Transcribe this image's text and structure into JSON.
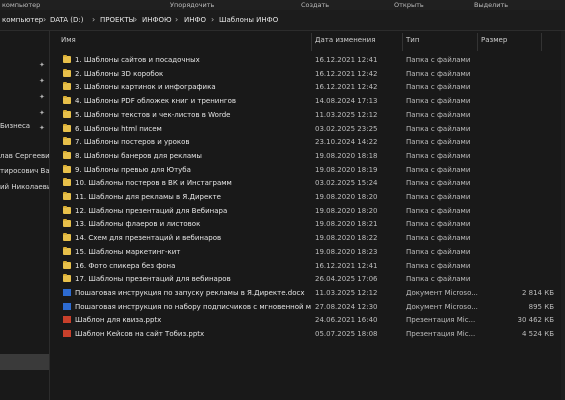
{
  "ribbon": {
    "items": [
      "компьютер",
      "Упорядочить",
      "Создать",
      "Открыть",
      "Выделить"
    ]
  },
  "address": {
    "crumbs": [
      "компьютер",
      "DATA (D:)",
      "ПРОЕКТЫ",
      "ИНФОЮ",
      "ИНФО",
      "Шаблоны ИНФО"
    ]
  },
  "nav": {
    "items": [
      "Бизнеса",
      "лав Сергеевич",
      "тиросович Вар",
      "ий Николаевич"
    ]
  },
  "columns": {
    "name": "Имя",
    "date": "Дата изменения",
    "type": "Тип",
    "size": "Размер"
  },
  "files": [
    {
      "name": "1. Шаблоны сайтов и посадочных",
      "date": "16.12.2021 12:41",
      "type": "Папка с файлами",
      "size": "",
      "icon": "folder"
    },
    {
      "name": "2. Шаблоны 3D коробок",
      "date": "16.12.2021 12:42",
      "type": "Папка с файлами",
      "size": "",
      "icon": "folder"
    },
    {
      "name": "3. Шаблоны картинок и инфографика",
      "date": "16.12.2021 12:42",
      "type": "Папка с файлами",
      "size": "",
      "icon": "folder"
    },
    {
      "name": "4. Шаблоны PDF обложек книг и тренингов",
      "date": "14.08.2024 17:13",
      "type": "Папка с файлами",
      "size": "",
      "icon": "folder"
    },
    {
      "name": "5. Шаблоны текстов и чек-листов в Worde",
      "date": "11.03.2025 12:12",
      "type": "Папка с файлами",
      "size": "",
      "icon": "folder"
    },
    {
      "name": "6. Шаблоны html писем",
      "date": "03.02.2025 23:25",
      "type": "Папка с файлами",
      "size": "",
      "icon": "folder"
    },
    {
      "name": "7. Шаблоны постеров и уроков",
      "date": "23.10.2024 14:22",
      "type": "Папка с файлами",
      "size": "",
      "icon": "folder"
    },
    {
      "name": "8. Шаблоны банеров для рекламы",
      "date": "19.08.2020 18:18",
      "type": "Папка с файлами",
      "size": "",
      "icon": "folder"
    },
    {
      "name": "9. Шаблоны превью для Ютуба",
      "date": "19.08.2020 18:19",
      "type": "Папка с файлами",
      "size": "",
      "icon": "folder"
    },
    {
      "name": "10. Шаблоны постеров в ВК и Инстаграмм",
      "date": "03.02.2025 15:24",
      "type": "Папка с файлами",
      "size": "",
      "icon": "folder"
    },
    {
      "name": "11. Шаблоны для рекламы в Я.Директе",
      "date": "19.08.2020 18:20",
      "type": "Папка с файлами",
      "size": "",
      "icon": "folder"
    },
    {
      "name": "12. Шаблоны презентаций для Вебинара",
      "date": "19.08.2020 18:20",
      "type": "Папка с файлами",
      "size": "",
      "icon": "folder"
    },
    {
      "name": "13. Шаблоны флаеров и листовок",
      "date": "19.08.2020 18:21",
      "type": "Папка с файлами",
      "size": "",
      "icon": "folder"
    },
    {
      "name": "14. Схем для презентаций и вебинаров",
      "date": "19.08.2020 18:22",
      "type": "Папка с файлами",
      "size": "",
      "icon": "folder"
    },
    {
      "name": "15. Шаблоны маркетинг-кит",
      "date": "19.08.2020 18:23",
      "type": "Папка с файлами",
      "size": "",
      "icon": "folder"
    },
    {
      "name": "16. Фото спикера без фона",
      "date": "16.12.2021 12:41",
      "type": "Папка с файлами",
      "size": "",
      "icon": "folder"
    },
    {
      "name": "17. Шаблоны презентаций для вебинаров",
      "date": "26.04.2025 17:06",
      "type": "Папка с файлами",
      "size": "",
      "icon": "folder"
    },
    {
      "name": "Пошаговая инструкция по запуску рекламы в Я.Директе.docx",
      "date": "11.03.2025 12:12",
      "type": "Документ Microso...",
      "size": "2 814 КБ",
      "icon": "docx"
    },
    {
      "name": "Пошаговая инструкция по набору подписчиков с мгновенной м...",
      "date": "27.08.2024 12:30",
      "type": "Документ Microso...",
      "size": "895 КБ",
      "icon": "docx"
    },
    {
      "name": "Шаблон для квиза.pptx",
      "date": "24.06.2021 16:40",
      "type": "Презентация Mic...",
      "size": "30 462 КБ",
      "icon": "pptx"
    },
    {
      "name": "Шаблон Кейсов на сайт Тобиз.pptx",
      "date": "05.07.2025 18:08",
      "type": "Презентация Mic...",
      "size": "4 524 КБ",
      "icon": "pptx"
    }
  ]
}
